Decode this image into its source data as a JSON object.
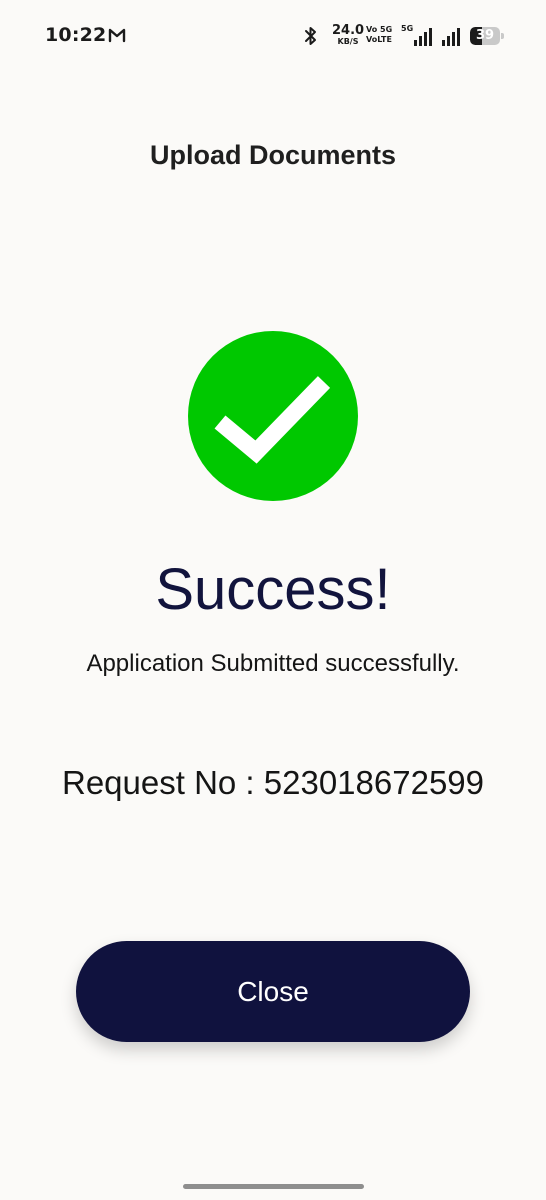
{
  "status_bar": {
    "time": "10:22",
    "notification_icon": "gmail-icon",
    "bluetooth_icon": "bluetooth-icon",
    "net_speed_value": "24.0",
    "net_speed_unit": "KB/S",
    "volte_top": "Vo 5G",
    "volte_bottom": "VoLTE",
    "network_label": "5G",
    "signal_icons": [
      "signal-icon",
      "signal-icon"
    ],
    "battery_level": "39"
  },
  "header": {
    "title": "Upload Documents"
  },
  "result": {
    "icon": "check-circle-icon",
    "icon_color": "#00c800",
    "title": "Success!",
    "message": "Application Submitted successfully.",
    "request_label": "Request No : ",
    "request_number": "523018672599"
  },
  "actions": {
    "close_label": "Close",
    "button_color": "#10123e"
  },
  "colors": {
    "background": "#fbfaf8",
    "title_text": "#12143d"
  }
}
